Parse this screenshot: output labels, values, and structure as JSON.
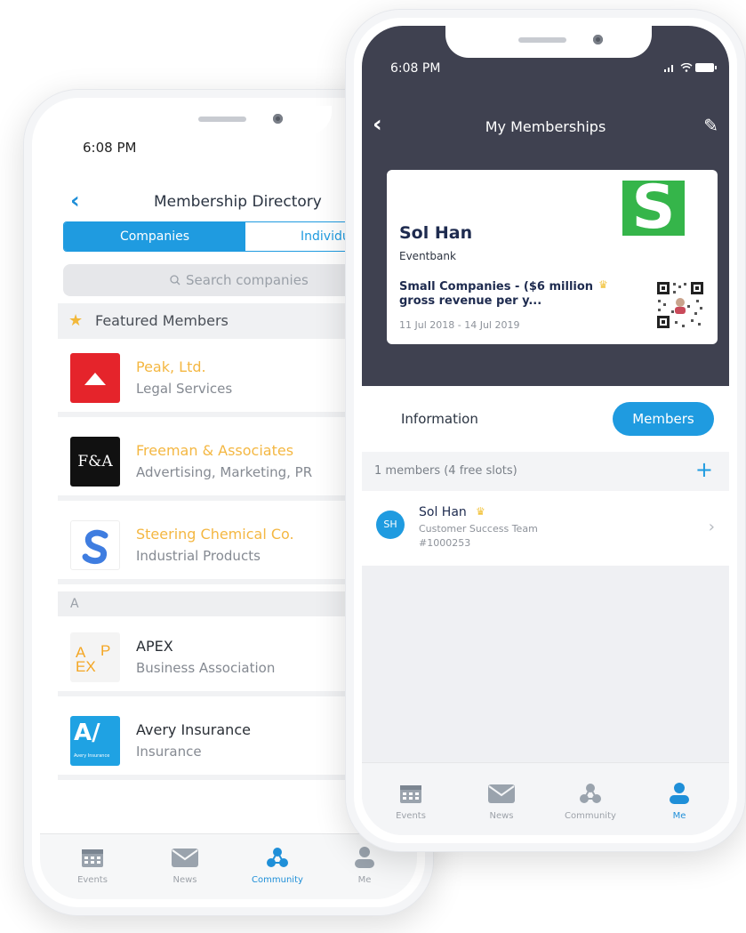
{
  "left_phone": {
    "status": {
      "time": "6:08 PM"
    },
    "header": {
      "title": "Membership Directory"
    },
    "segments": [
      "Companies",
      "Individuals"
    ],
    "search": {
      "placeholder": "Search companies"
    },
    "featured": {
      "label": "Featured Members"
    },
    "companies": [
      {
        "name": "Peak, Ltd.",
        "category": "Legal Services",
        "logo": "peak-logo",
        "logo_color": "#e5242b"
      },
      {
        "name": "Freeman & Associates",
        "category": "Advertising, Marketing, PR",
        "logo": "freeman-logo",
        "logo_text": "F&A"
      },
      {
        "name": "Steering Chemical Co.",
        "category": "Industrial Products",
        "logo": "steering-logo"
      }
    ],
    "section": "A",
    "members": [
      {
        "name": "APEX",
        "category": "Business Association",
        "logo": "apex-logo"
      },
      {
        "name": "Avery Insurance",
        "category": "Insurance",
        "logo": "avery-logo",
        "logo_text": "A/",
        "logo_caption": "Avery Insurance"
      }
    ],
    "tabs": [
      {
        "label": "Events",
        "icon": "calendar-icon"
      },
      {
        "label": "News",
        "icon": "envelope-icon"
      },
      {
        "label": "Community",
        "icon": "community-icon",
        "active": true
      },
      {
        "label": "Me",
        "icon": "person-icon"
      }
    ]
  },
  "right_phone": {
    "status": {
      "time": "6:08 PM"
    },
    "header": {
      "title": "My Memberships"
    },
    "card": {
      "name": "Sol Han",
      "organization": "Eventbank",
      "plan": "Small Companies - ($6 million gross revenue per y...",
      "dates": "11 Jul 2018 - 14 Jul 2019",
      "logo_letter": "S"
    },
    "tabs": {
      "information": "Information",
      "members": "Members"
    },
    "members_count": "1 members (4 free slots)",
    "member": {
      "initials": "SH",
      "name": "Sol Han",
      "team": "Customer Success Team",
      "id": "#1000253"
    },
    "tabbar": [
      {
        "label": "Events",
        "icon": "calendar-icon"
      },
      {
        "label": "News",
        "icon": "envelope-icon"
      },
      {
        "label": "Community",
        "icon": "community-icon"
      },
      {
        "label": "Me",
        "icon": "person-icon",
        "active": true
      }
    ]
  },
  "colors": {
    "accent": "#1f9be0",
    "gold": "#f4b742",
    "header_dark": "#3f4150",
    "green_logo": "#35b54a"
  }
}
